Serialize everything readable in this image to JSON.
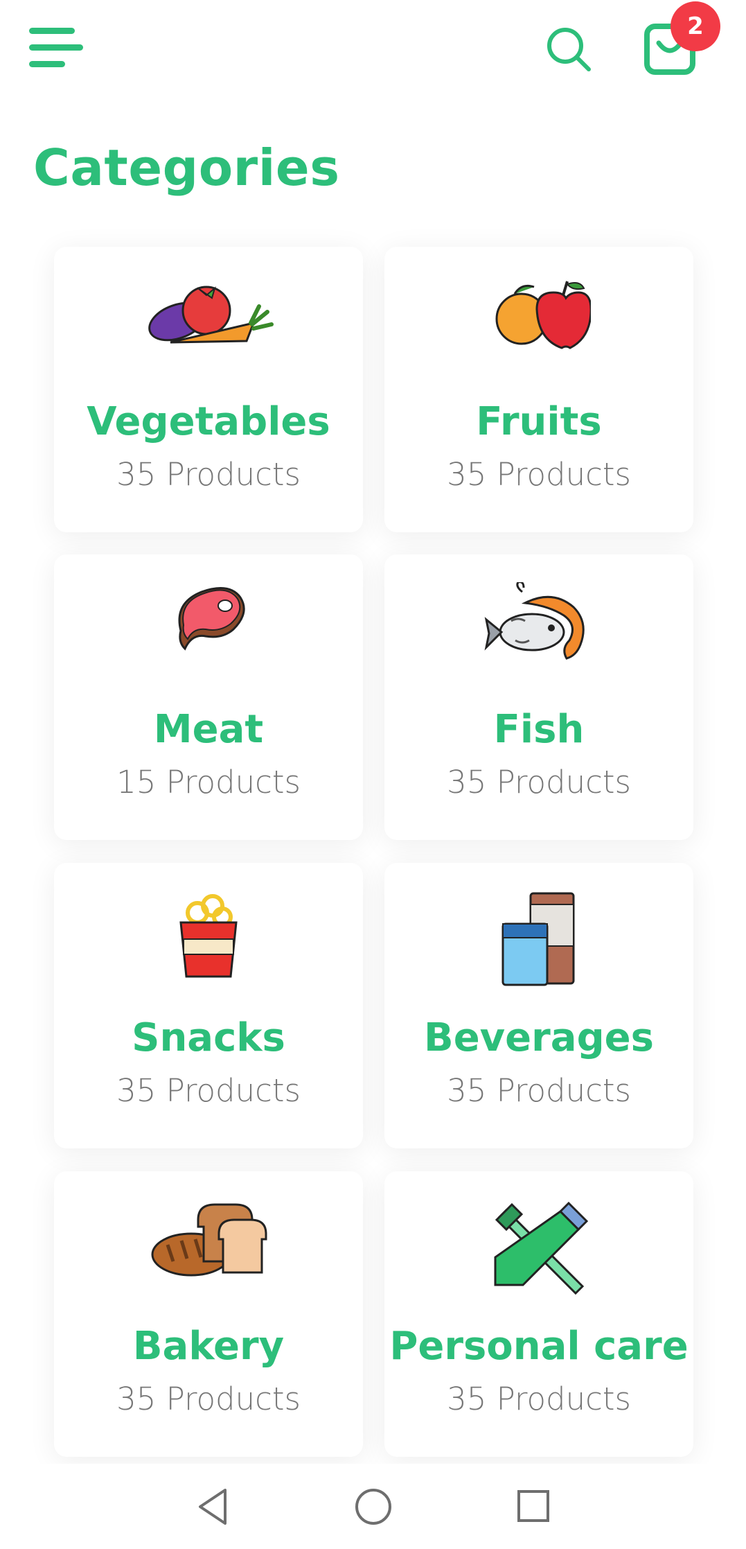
{
  "header": {
    "menu_icon": "menu-icon",
    "search_icon": "search-icon",
    "cart_icon": "shopping-bag-icon",
    "cart_count": "2"
  },
  "page_title": "Categories",
  "categories": [
    {
      "name": "Vegetables",
      "count": "35 Products",
      "icon": "vegetables-icon"
    },
    {
      "name": "Fruits",
      "count": "35 Products",
      "icon": "fruits-icon"
    },
    {
      "name": "Meat",
      "count": "15 Products",
      "icon": "meat-icon"
    },
    {
      "name": "Fish",
      "count": "35 Products",
      "icon": "fish-icon"
    },
    {
      "name": "Snacks",
      "count": "35 Products",
      "icon": "snacks-icon"
    },
    {
      "name": "Beverages",
      "count": "35 Products",
      "icon": "milk-icon"
    },
    {
      "name": "Bakery",
      "count": "35 Products",
      "icon": "bread-icon"
    },
    {
      "name": "Personal care",
      "count": "35 Products",
      "icon": "toothbrush-icon"
    }
  ],
  "system_nav": {
    "back_icon": "back-icon",
    "home_icon": "home-icon",
    "recents_icon": "recents-icon"
  },
  "colors": {
    "accent": "#2dbe7a",
    "badge": "#f23b46",
    "muted_text": "#777777"
  }
}
